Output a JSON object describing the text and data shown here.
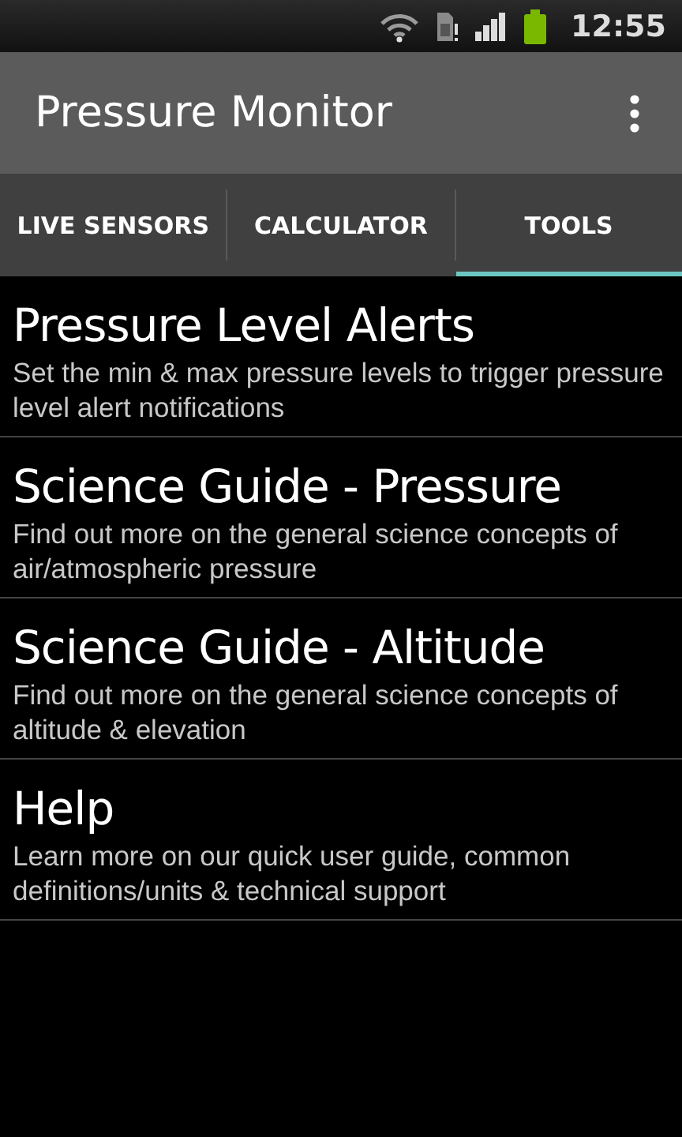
{
  "status_bar": {
    "time": "12:55"
  },
  "action_bar": {
    "title": "Pressure Monitor"
  },
  "tabs": [
    {
      "label": "LIVE SENSORS",
      "selected": false
    },
    {
      "label": "CALCULATOR",
      "selected": false
    },
    {
      "label": "TOOLS",
      "selected": true
    }
  ],
  "items": [
    {
      "title": "Pressure Level Alerts",
      "subtitle": "Set the min & max pressure levels to trigger pressure level alert notifications"
    },
    {
      "title": "Science Guide - Pressure",
      "subtitle": "Find out more on the general science concepts of air/atmospheric pressure"
    },
    {
      "title": "Science Guide - Altitude",
      "subtitle": "Find out more on the general science concepts of altitude & elevation"
    },
    {
      "title": "Help",
      "subtitle": "Learn more on our quick user guide, common definitions/units & technical support"
    }
  ]
}
